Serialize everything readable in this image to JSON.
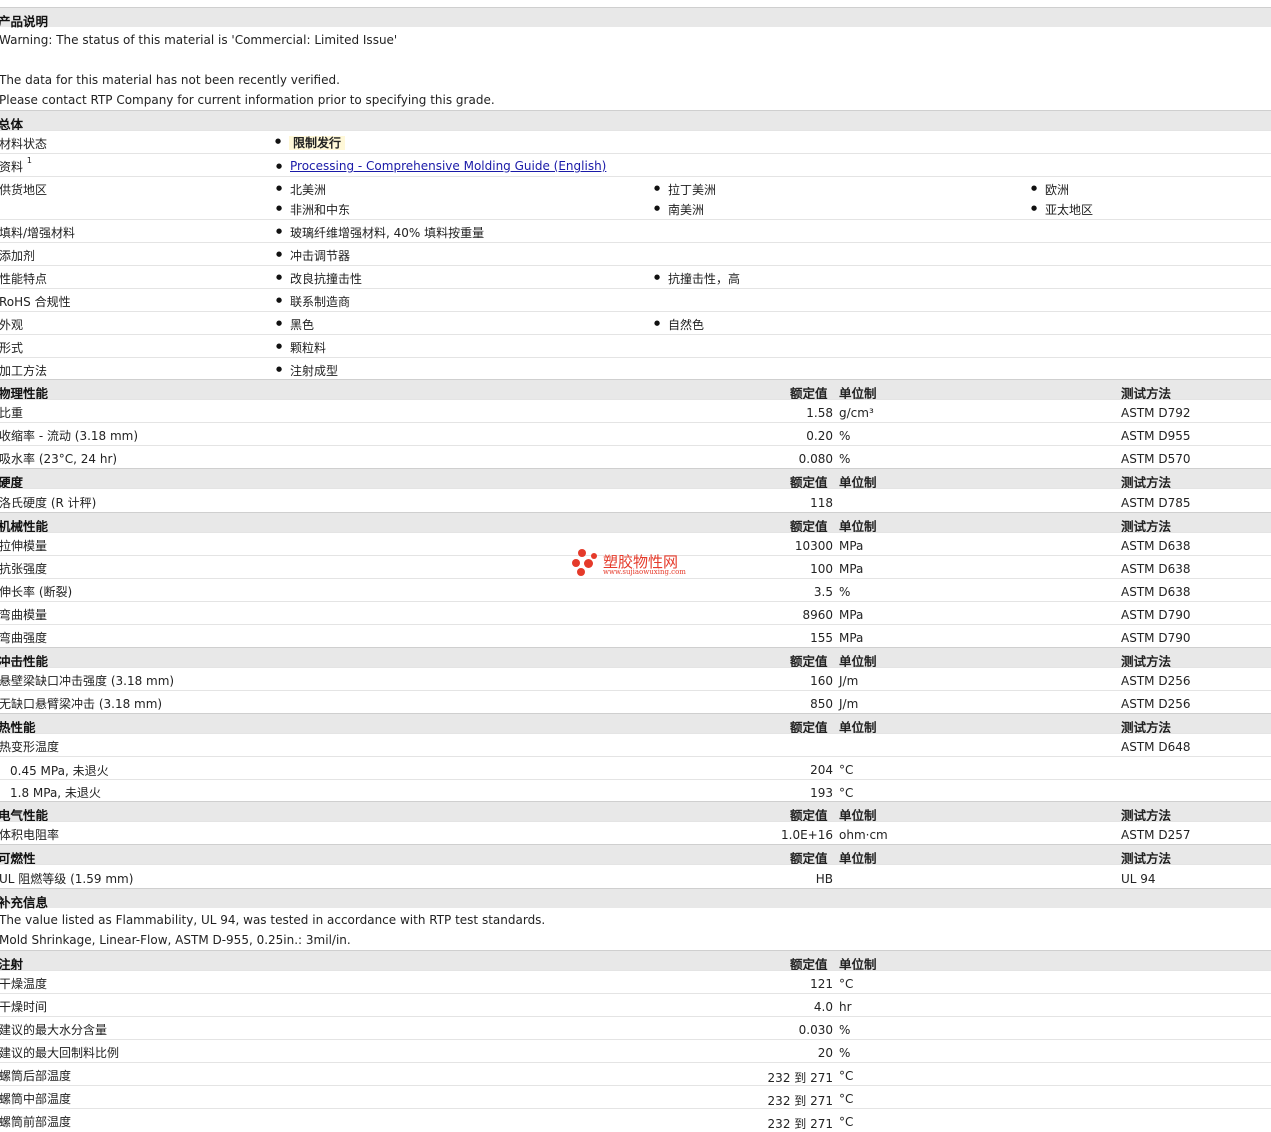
{
  "overview": {
    "title": "产品说明",
    "lines": [
      "Warning: The status of this material is 'Commercial: Limited Issue'",
      "The data for this material has not been recently verified.",
      "Please contact RTP Company for current information prior to specifying this grade."
    ]
  },
  "general": {
    "title": "总体",
    "material_status_label": "材料状态",
    "material_status_value": "限制发行",
    "docs_label": "资料",
    "docs_sup": "1",
    "docs_link": "Processing - Comprehensive Molding Guide (English)",
    "availability_label": "供货地区",
    "availability": [
      "北美洲",
      "拉丁美洲",
      "欧洲",
      "非洲和中东",
      "南美洲",
      "亚太地区"
    ],
    "filler_label": "填料/增强材料",
    "filler_value": "玻璃纤维增强材料, 40% 填料按重量",
    "additive_label": "添加剂",
    "additive_value": "冲击调节器",
    "features_label": "性能特点",
    "features": [
      "改良抗撞击性",
      "抗撞击性，高"
    ],
    "rohs_label": "RoHS 合规性",
    "rohs_value": "联系制造商",
    "appearance_label": "外观",
    "appearance": [
      "黑色",
      "自然色"
    ],
    "form_label": "形式",
    "form_value": "颗粒料",
    "processing_label": "加工方法",
    "processing_value": "注射成型"
  },
  "col_headers": {
    "nominal": "额定值",
    "unit": "单位制",
    "method": "测试方法"
  },
  "sections": {
    "physical": {
      "title": "物理性能",
      "rows": [
        {
          "label": "比重",
          "value": "1.58",
          "unit": "g/cm³",
          "method": "ASTM D792"
        },
        {
          "label": "收缩率 - 流动 (3.18 mm)",
          "value": "0.20",
          "unit": "%",
          "method": "ASTM D955"
        },
        {
          "label": "吸水率 (23°C, 24 hr)",
          "value": "0.080",
          "unit": "%",
          "method": "ASTM D570"
        }
      ]
    },
    "hardness": {
      "title": "硬度",
      "rows": [
        {
          "label": "洛氏硬度 (R 计秤)",
          "value": "118",
          "unit": "",
          "method": "ASTM D785"
        }
      ]
    },
    "mechanical": {
      "title": "机械性能",
      "rows": [
        {
          "label": "拉伸模量",
          "value": "10300",
          "unit": "MPa",
          "method": "ASTM D638"
        },
        {
          "label": "抗张强度",
          "value": "100",
          "unit": "MPa",
          "method": "ASTM D638"
        },
        {
          "label": "伸长率 (断裂)",
          "value": "3.5",
          "unit": "%",
          "method": "ASTM D638"
        },
        {
          "label": "弯曲模量",
          "value": "8960",
          "unit": "MPa",
          "method": "ASTM D790"
        },
        {
          "label": "弯曲强度",
          "value": "155",
          "unit": "MPa",
          "method": "ASTM D790"
        }
      ]
    },
    "impact": {
      "title": "冲击性能",
      "rows": [
        {
          "label": "悬壁梁缺口冲击强度 (3.18 mm)",
          "value": "160",
          "unit": "J/m",
          "method": "ASTM D256"
        },
        {
          "label": "无缺口悬臂梁冲击 (3.18 mm)",
          "value": "850",
          "unit": "J/m",
          "method": "ASTM D256"
        }
      ]
    },
    "thermal": {
      "title": "热性能",
      "hdt_label": "热变形温度",
      "hdt_method": "ASTM D648",
      "rows": [
        {
          "label": "0.45 MPa, 未退火",
          "value": "204",
          "unit": "°C"
        },
        {
          "label": "1.8 MPa, 未退火",
          "value": "193",
          "unit": "°C"
        }
      ]
    },
    "electrical": {
      "title": "电气性能",
      "rows": [
        {
          "label": "体积电阻率",
          "value": "1.0E+16",
          "unit": "ohm·cm",
          "method": "ASTM D257"
        }
      ]
    },
    "flammability": {
      "title": "可燃性",
      "rows": [
        {
          "label": "UL 阻燃等级 (1.59 mm)",
          "value": "HB",
          "unit": "",
          "method": "UL 94"
        }
      ]
    },
    "supplemental": {
      "title": "补充信息",
      "lines": [
        "The value listed as Flammability, UL 94, was tested in accordance with RTP test standards.",
        "Mold Shrinkage, Linear-Flow, ASTM D-955, 0.25in.: 3mil/in."
      ]
    },
    "injection": {
      "title": "注射",
      "rows": [
        {
          "label": "干燥温度",
          "value": "121",
          "unit": "°C"
        },
        {
          "label": "干燥时间",
          "value": "4.0",
          "unit": "hr"
        },
        {
          "label": "建议的最大水分含量",
          "value": "0.030",
          "unit": "%"
        },
        {
          "label": "建议的最大回制料比例",
          "value": "20",
          "unit": "%"
        },
        {
          "label": "螺筒后部温度",
          "value": "232 到 271",
          "unit": "°C"
        },
        {
          "label": "螺筒中部温度",
          "value": "232 到 271",
          "unit": "°C"
        },
        {
          "label": "螺筒前部温度",
          "value": "232 到 271",
          "unit": "°C"
        }
      ]
    }
  },
  "watermark": {
    "name": "塑胶物性网",
    "url": "www.sujiaowuxing.com",
    "color": "#e53a2a"
  }
}
